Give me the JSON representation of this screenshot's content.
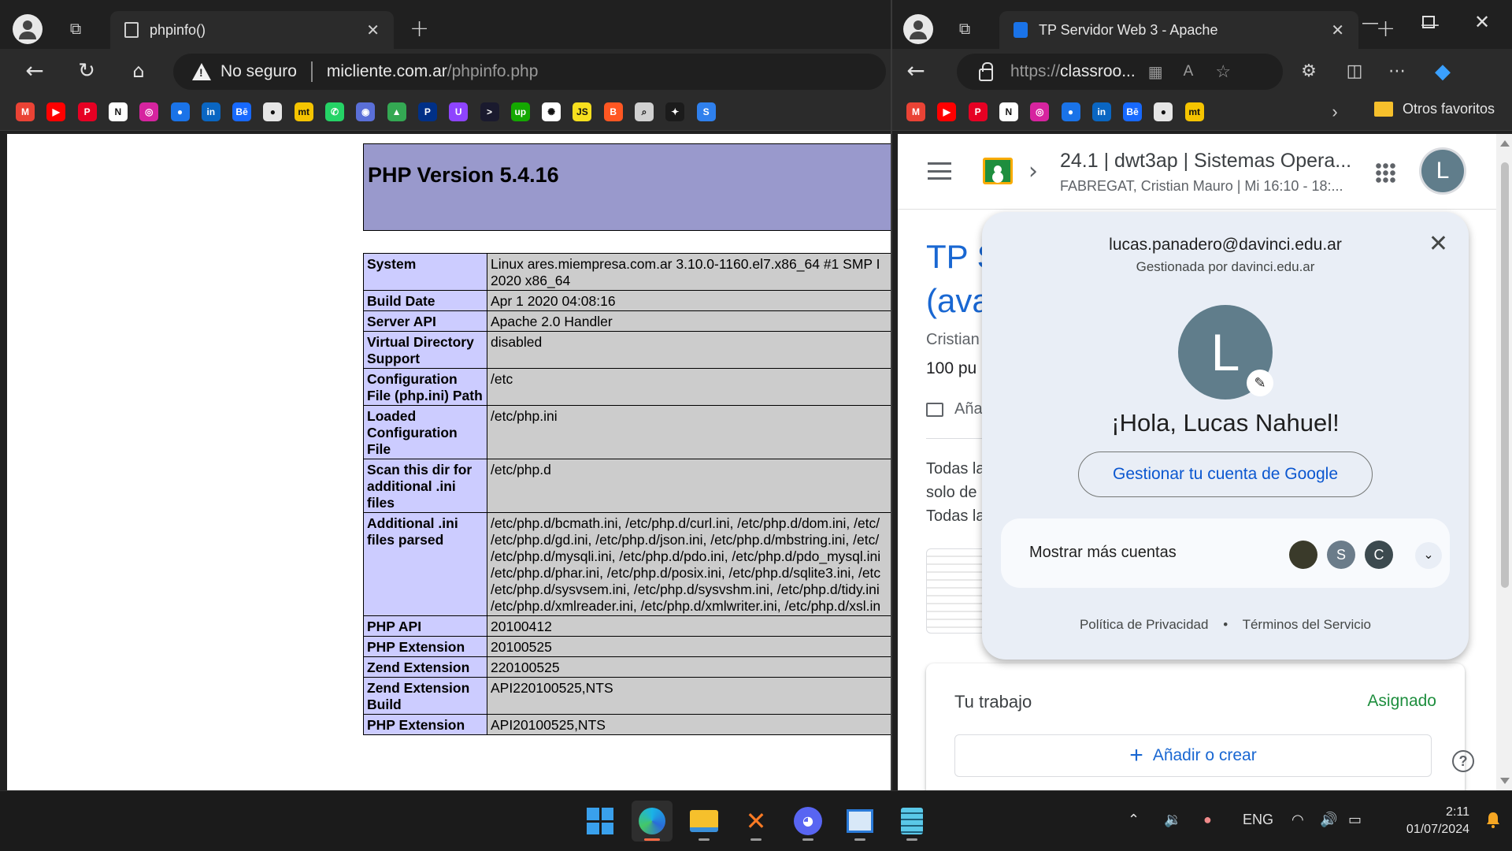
{
  "left_browser": {
    "tab": {
      "title": "phpinfo()"
    },
    "address": {
      "security": "No seguro",
      "domain": "micliente.com.ar",
      "path": "/phpinfo.php"
    },
    "bookmarks": [
      {
        "name": "gmail-bookmark",
        "glyph": "M",
        "color": "#ea4335"
      },
      {
        "name": "youtube-bookmark",
        "glyph": "▶",
        "color": "#ff0000"
      },
      {
        "name": "pinterest-bookmark",
        "glyph": "P",
        "color": "#e60023"
      },
      {
        "name": "notion-bookmark",
        "glyph": "N",
        "color": "#ffffff"
      },
      {
        "name": "instagram-bookmark",
        "glyph": "◎",
        "color": "#d6249f"
      },
      {
        "name": "classroom-bookmark",
        "glyph": "●",
        "color": "#1a73e8"
      },
      {
        "name": "linkedin-bookmark",
        "glyph": "in",
        "color": "#0a66c2"
      },
      {
        "name": "behance-bookmark",
        "glyph": "Bē",
        "color": "#1769ff"
      },
      {
        "name": "github-bookmark",
        "glyph": "●",
        "color": "#e6e6e6"
      },
      {
        "name": "mt-bookmark",
        "glyph": "mt",
        "color": "#f5c400"
      },
      {
        "name": "whatsapp-bookmark",
        "glyph": "✆",
        "color": "#25d366"
      },
      {
        "name": "vpn-bookmark",
        "glyph": "◉",
        "color": "#5a6fd8"
      },
      {
        "name": "drive-bookmark",
        "glyph": "▲",
        "color": "#34a853"
      },
      {
        "name": "paypal-bookmark",
        "glyph": "P",
        "color": "#003087"
      },
      {
        "name": "u-bookmark",
        "glyph": "U",
        "color": "#8e44ff"
      },
      {
        "name": "prompt-bookmark",
        "glyph": ">",
        "color": "#1a1a2e"
      },
      {
        "name": "upwork-bookmark",
        "glyph": "up",
        "color": "#14a800"
      },
      {
        "name": "openai-bookmark",
        "glyph": "✺",
        "color": "#ffffff"
      },
      {
        "name": "js-bookmark",
        "glyph": "JS",
        "color": "#f7df1e"
      },
      {
        "name": "blogger-bookmark",
        "glyph": "B",
        "color": "#ff5722"
      },
      {
        "name": "search-bookmark",
        "glyph": "⌕",
        "color": "#d0d0d0"
      },
      {
        "name": "star-bookmark",
        "glyph": "✦",
        "color": "#1b1b1b"
      },
      {
        "name": "s-bookmark",
        "glyph": "S",
        "color": "#2f80ed"
      }
    ],
    "php": {
      "version": "PHP Version 5.4.16",
      "rows": [
        {
          "k": "System",
          "v": "Linux ares.miempresa.com.ar 3.10.0-1160.el7.x86_64 #1 SMP I\n2020 x86_64"
        },
        {
          "k": "Build Date",
          "v": "Apr 1 2020 04:08:16"
        },
        {
          "k": "Server API",
          "v": "Apache 2.0 Handler"
        },
        {
          "k": "Virtual Directory Support",
          "v": "disabled"
        },
        {
          "k": "Configuration File (php.ini) Path",
          "v": "/etc"
        },
        {
          "k": "Loaded Configuration File",
          "v": "/etc/php.ini"
        },
        {
          "k": "Scan this dir for additional .ini files",
          "v": "/etc/php.d"
        },
        {
          "k": "Additional .ini files parsed",
          "v": "/etc/php.d/bcmath.ini, /etc/php.d/curl.ini, /etc/php.d/dom.ini, /etc/\n/etc/php.d/gd.ini, /etc/php.d/json.ini, /etc/php.d/mbstring.ini, /etc/\n/etc/php.d/mysqli.ini, /etc/php.d/pdo.ini, /etc/php.d/pdo_mysql.ini\n/etc/php.d/phar.ini, /etc/php.d/posix.ini, /etc/php.d/sqlite3.ini, /etc\n/etc/php.d/sysvsem.ini, /etc/php.d/sysvshm.ini, /etc/php.d/tidy.ini\n/etc/php.d/xmlreader.ini, /etc/php.d/xmlwriter.ini, /etc/php.d/xsl.in"
        },
        {
          "k": "PHP API",
          "v": "20100412"
        },
        {
          "k": "PHP Extension",
          "v": "20100525"
        },
        {
          "k": "Zend Extension",
          "v": "220100525"
        },
        {
          "k": "Zend Extension Build",
          "v": "API220100525,NTS"
        },
        {
          "k": "PHP Extension",
          "v": "API20100525,NTS"
        }
      ]
    }
  },
  "right_browser": {
    "tab": {
      "title": "TP Servidor Web 3 - Apache"
    },
    "address": {
      "scheme": "https://",
      "host": "classroo..."
    },
    "bookmarks": [
      {
        "name": "gmail-bookmark",
        "glyph": "M",
        "color": "#ea4335"
      },
      {
        "name": "youtube-bookmark",
        "glyph": "▶",
        "color": "#ff0000"
      },
      {
        "name": "pinterest-bookmark",
        "glyph": "P",
        "color": "#e60023"
      },
      {
        "name": "notion-bookmark",
        "glyph": "N",
        "color": "#ffffff"
      },
      {
        "name": "instagram-bookmark",
        "glyph": "◎",
        "color": "#d6249f"
      },
      {
        "name": "classroom-bookmark",
        "glyph": "●",
        "color": "#1a73e8"
      },
      {
        "name": "linkedin-bookmark",
        "glyph": "in",
        "color": "#0a66c2"
      },
      {
        "name": "behance-bookmark",
        "glyph": "Bē",
        "color": "#1769ff"
      },
      {
        "name": "github-bookmark",
        "glyph": "●",
        "color": "#e6e6e6"
      },
      {
        "name": "mt-bookmark",
        "glyph": "mt",
        "color": "#f5c400"
      }
    ],
    "other_favorites": "Otros favoritos",
    "classroom": {
      "crumb_title": "24.1 | dwt3ap | Sistemas Opera...",
      "crumb_sub": "FABREGAT, Cristian Mauro | Mi 16:10 - 18:...",
      "avatar_letter": "L",
      "bg_title_1": "TP S",
      "bg_title_2": "(ava",
      "bg_teacher": "Cristian",
      "bg_points": "100 pu",
      "bg_comment": "Aña",
      "bg_body": [
        "Todas la",
        "solo de",
        "Todas la"
      ],
      "work_title": "Tu trabajo",
      "work_status": "Asignado",
      "work_add": "Añadir o crear",
      "help": "?"
    },
    "account": {
      "email": "lucas.panadero@davinci.edu.ar",
      "managed_by": "Gestionada por davinci.edu.ar",
      "avatar_letter": "L",
      "greeting": "¡Hola, Lucas Nahuel!",
      "manage_button": "Gestionar tu cuenta de Google",
      "more_accounts": "Mostrar más cuentas",
      "other_accounts": [
        {
          "letter": "",
          "color": "#3a3a2a"
        },
        {
          "letter": "S",
          "color": "#6b7c8a"
        },
        {
          "letter": "C",
          "color": "#3c4a4f"
        }
      ],
      "privacy": "Política de Privacidad",
      "terms": "Términos del Servicio"
    }
  },
  "taskbar": {
    "language": "ENG",
    "time": "2:11",
    "date": "01/07/2024"
  }
}
